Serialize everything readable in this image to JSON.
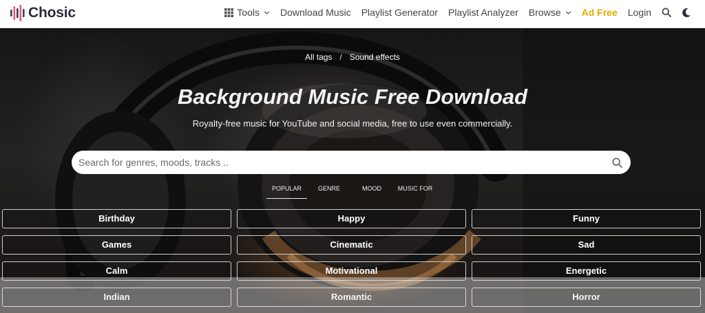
{
  "header": {
    "logo_text": "Chosic",
    "nav": {
      "tools": "Tools",
      "download_music": "Download Music",
      "playlist_generator": "Playlist Generator",
      "playlist_analyzer": "Playlist Analyzer",
      "browse": "Browse",
      "ad_free": "Ad Free",
      "login": "Login"
    },
    "icons": [
      "grid-icon",
      "chevron-down-icon",
      "search-icon",
      "moon-icon"
    ]
  },
  "colors": {
    "ad_free": "#e6a800",
    "logo_bars": [
      "#3b3b5c",
      "#e45b7a",
      "#3b3b5c",
      "#e45b7a",
      "#3b3b5c"
    ]
  },
  "hero": {
    "breadcrumb": {
      "all_tags": "All tags",
      "separator": "/",
      "current": "Sound effects"
    },
    "title": "Background Music Free Download",
    "subtitle": "Royalty-free music for YouTube and social media, free to use even commercially.",
    "search": {
      "placeholder": "Search for genres, moods, tracks ..",
      "value": ""
    },
    "tabs": [
      {
        "label": "POPULAR",
        "active": true
      },
      {
        "label": "GENRE",
        "active": false
      },
      {
        "label": "MOOD",
        "active": false
      },
      {
        "label": "MUSIC FOR",
        "active": false
      }
    ],
    "categories": [
      "Birthday",
      "Happy",
      "Funny",
      "Games",
      "Cinematic",
      "Sad",
      "Calm",
      "Motivational",
      "Energetic",
      "Indian",
      "Romantic",
      "Horror"
    ]
  }
}
